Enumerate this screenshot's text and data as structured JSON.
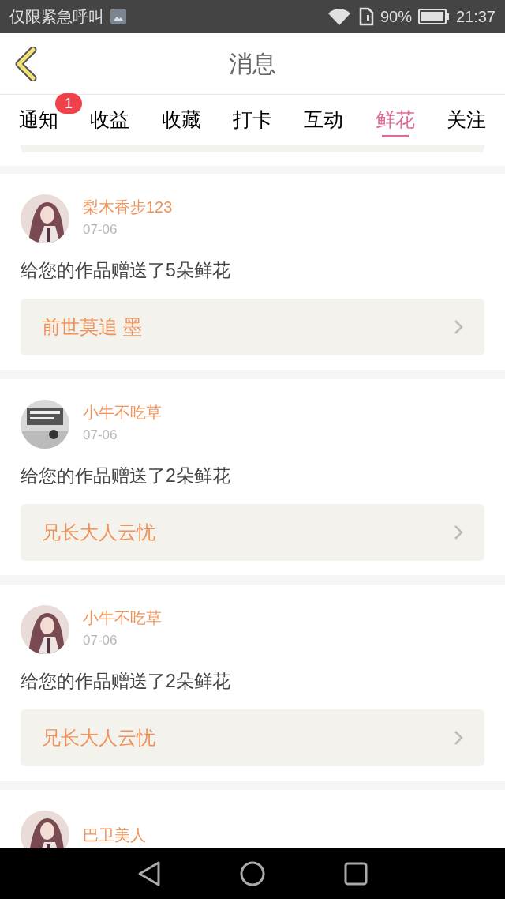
{
  "status_bar": {
    "carrier": "仅限紧急呼叫",
    "battery": "90%",
    "time": "21:37"
  },
  "header": {
    "title": "消息"
  },
  "tabs": [
    {
      "label": "通知",
      "selected": false,
      "badge": "1"
    },
    {
      "label": "收益",
      "selected": false
    },
    {
      "label": "收藏",
      "selected": false
    },
    {
      "label": "打卡",
      "selected": false
    },
    {
      "label": "互动",
      "selected": false
    },
    {
      "label": "鲜花",
      "selected": true
    },
    {
      "label": "关注",
      "selected": false
    }
  ],
  "messages": [
    {
      "user": "梨木香步123",
      "date": "07-06",
      "text": "给您的作品赠送了5朵鲜花",
      "work": "前世莫追 墨"
    },
    {
      "user": "小牛不吃草",
      "date": "07-06",
      "text": "给您的作品赠送了2朵鲜花",
      "work": "兄长大人云忧"
    },
    {
      "user": "小牛不吃草",
      "date": "07-06",
      "text": "给您的作品赠送了2朵鲜花",
      "work": "兄长大人云忧"
    },
    {
      "user": "巴卫美人"
    }
  ]
}
